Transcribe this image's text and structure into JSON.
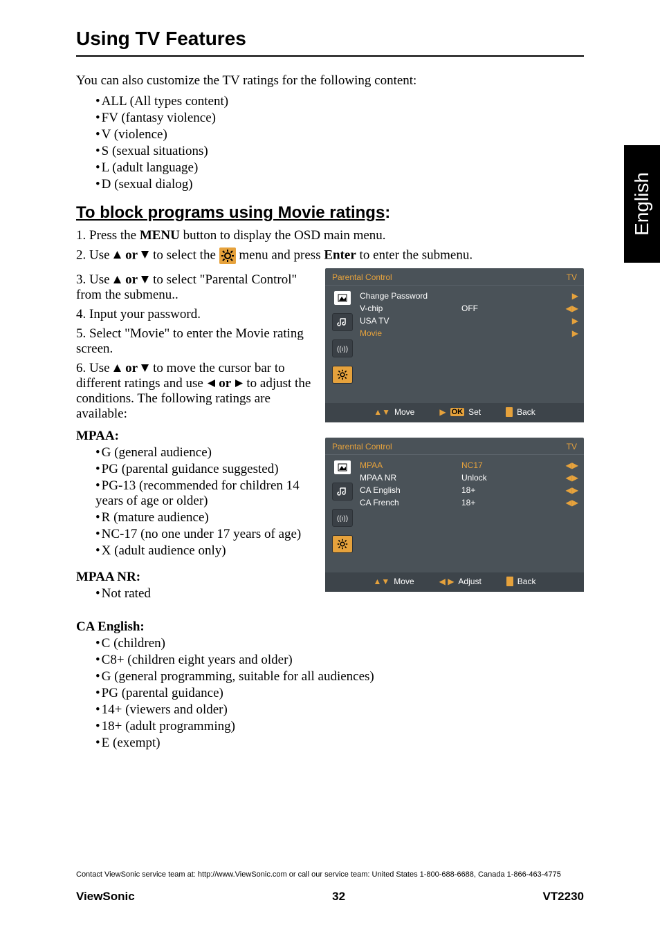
{
  "title": "Using TV Features",
  "intro": "You can also customize the TV ratings for the following content:",
  "ratings_content": [
    "ALL (All types content)",
    "FV (fantasy violence)",
    "V (violence)",
    "S (sexual situations)",
    "L (adult language)",
    "D (sexual dialog)"
  ],
  "sub_heading_ul": "To block programs using Movie ratings",
  "sub_heading_colon": ":",
  "steps": {
    "s1_a": "1. Press the ",
    "s1_b": "MENU",
    "s1_c": " button to display the OSD main menu.",
    "s2_a": "2. Use ",
    "s2_b": " to select the ",
    "s2_c": " menu and press ",
    "s2_enter": "Enter",
    "s2_d": " to enter the submenu.",
    "s3_a": "3. Use ",
    "s3_b": " to select  \"Parental Control\" from the submenu..",
    "s4": "4. Input your password.",
    "s5": "5. Select \"Movie\" to enter the Movie rating screen.",
    "s6_a": "6. Use ",
    "s6_b": " to move the cursor bar to different ratings and use ",
    "s6_c": " to adjust the conditions. The following ratings are available:",
    "or": " or "
  },
  "mpaa_heading": "MPAA:",
  "mpaa_list": [
    "G (general audience)",
    "PG (parental guidance suggested)",
    "PG-13 (recommended for children 14 years of age or older)",
    "R (mature audience)",
    "NC-17 (no one under 17 years of age)",
    "X (adult audience only)"
  ],
  "mpaa_nr_heading": "MPAA NR:",
  "mpaa_nr_list": [
    "Not rated"
  ],
  "ca_eng_heading": "CA English:",
  "ca_eng_list": [
    "C (children)",
    "C8+ (children eight years and older)",
    "G (general programming, suitable for all audiences)",
    "PG (parental guidance)",
    "14+ (viewers and older)",
    "18+ (adult programming)",
    "E (exempt)"
  ],
  "osd1": {
    "title": "Parental Control",
    "tv": "TV",
    "rows": [
      {
        "l": "Change Password",
        "m": "",
        "hl": false,
        "arrow": "▶"
      },
      {
        "l": "V-chip",
        "m": "OFF",
        "hl": false,
        "arrow": "◀▶"
      },
      {
        "l": "USA TV",
        "m": "",
        "hl": false,
        "arrow": "▶"
      },
      {
        "l": "Movie",
        "m": "",
        "hl": true,
        "arrow": "▶"
      }
    ],
    "footer": {
      "move": "Move",
      "action": "Set",
      "back": "Back",
      "action_type": "ok"
    }
  },
  "osd2": {
    "title": "Parental Control",
    "tv": "TV",
    "rows": [
      {
        "l": "MPAA",
        "m": "NC17",
        "hl_l": true,
        "hl_m": true,
        "arrow": "◀▶"
      },
      {
        "l": "MPAA NR",
        "m": "Unlock",
        "hl_l": false,
        "hl_m": false,
        "arrow": "◀▶"
      },
      {
        "l": "CA English",
        "m": "18+",
        "hl_l": false,
        "hl_m": false,
        "arrow": "◀▶"
      },
      {
        "l": "CA French",
        "m": "18+",
        "hl_l": false,
        "hl_m": false,
        "arrow": "◀▶"
      }
    ],
    "footer": {
      "move": "Move",
      "action": "Adjust",
      "back": "Back",
      "action_type": "lr"
    }
  },
  "side_tab": "English",
  "contact_line": "Contact ViewSonic service team at: http://www.ViewSonic.com or call our service team: United States 1-800-688-6688, Canada 1-866-463-4775",
  "footer": {
    "left": "ViewSonic",
    "center": "32",
    "right": "VT2230"
  }
}
